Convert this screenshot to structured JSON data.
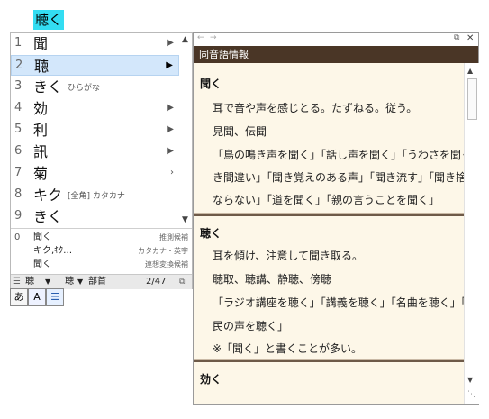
{
  "composition": "聴く",
  "candidates": {
    "items": [
      {
        "num": "1",
        "text": "聞",
        "note": "",
        "arrow": "▶"
      },
      {
        "num": "2",
        "text": "聴",
        "note": "",
        "arrow": "▶"
      },
      {
        "num": "3",
        "text": "きく",
        "note": "ひらがな",
        "arrow": ""
      },
      {
        "num": "4",
        "text": "効",
        "note": "",
        "arrow": "▶"
      },
      {
        "num": "5",
        "text": "利",
        "note": "",
        "arrow": "▶"
      },
      {
        "num": "6",
        "text": "訊",
        "note": "",
        "arrow": "▶"
      },
      {
        "num": "7",
        "text": "菊",
        "note": "",
        "arrow": "›"
      },
      {
        "num": "8",
        "text": "キク",
        "note": "[全角] カタカナ",
        "arrow": ""
      },
      {
        "num": "9",
        "text": "きく",
        "note": "",
        "arrow": ""
      }
    ],
    "lower": [
      {
        "num": "0",
        "word": "聞く",
        "hint": "推測候補"
      },
      {
        "num": "",
        "word": "キク,ｷｸ…",
        "hint": "カタカナ・英字"
      },
      {
        "num": "",
        "word": "聞く",
        "hint": "連想変換候補"
      }
    ],
    "status": {
      "kanji": "聴",
      "kanji2": "聴",
      "radical": "部首",
      "page": "2/47"
    }
  },
  "mode": {
    "hiragana": "あ",
    "kana_label": "A",
    "list_icon": "list-icon"
  },
  "info": {
    "title": "同音語情報",
    "sections": [
      {
        "head": "聞く",
        "lines": [
          "耳で音や声を感じとる。たずねる。従う。",
          "見聞、伝聞",
          "「鳥の鳴き声を聞く」「話し声を聞く」「うわさを聞く」「聞",
          "き間違い」「聞き覚えのある声」「聞き流す」「聞き捨て",
          "ならない」「道を聞く」「親の言うことを聞く」"
        ]
      },
      {
        "head": "聴く",
        "lines": [
          "耳を傾け、注意して聞き取る。",
          "聴取、聴講、静聴、傍聴",
          "「ラジオ講座を聴く」「講義を聴く」「名曲を聴く」「広く国",
          "民の声を聴く」",
          "※「聞く」と書くことが多い。"
        ]
      },
      {
        "head": "効く",
        "lines": []
      }
    ]
  },
  "colors": {
    "composition_bg": "#33ddf2",
    "selected_row": "#d3e7fb",
    "info_title_bg": "#4a3626",
    "info_body_bg": "#fdf7e8"
  }
}
